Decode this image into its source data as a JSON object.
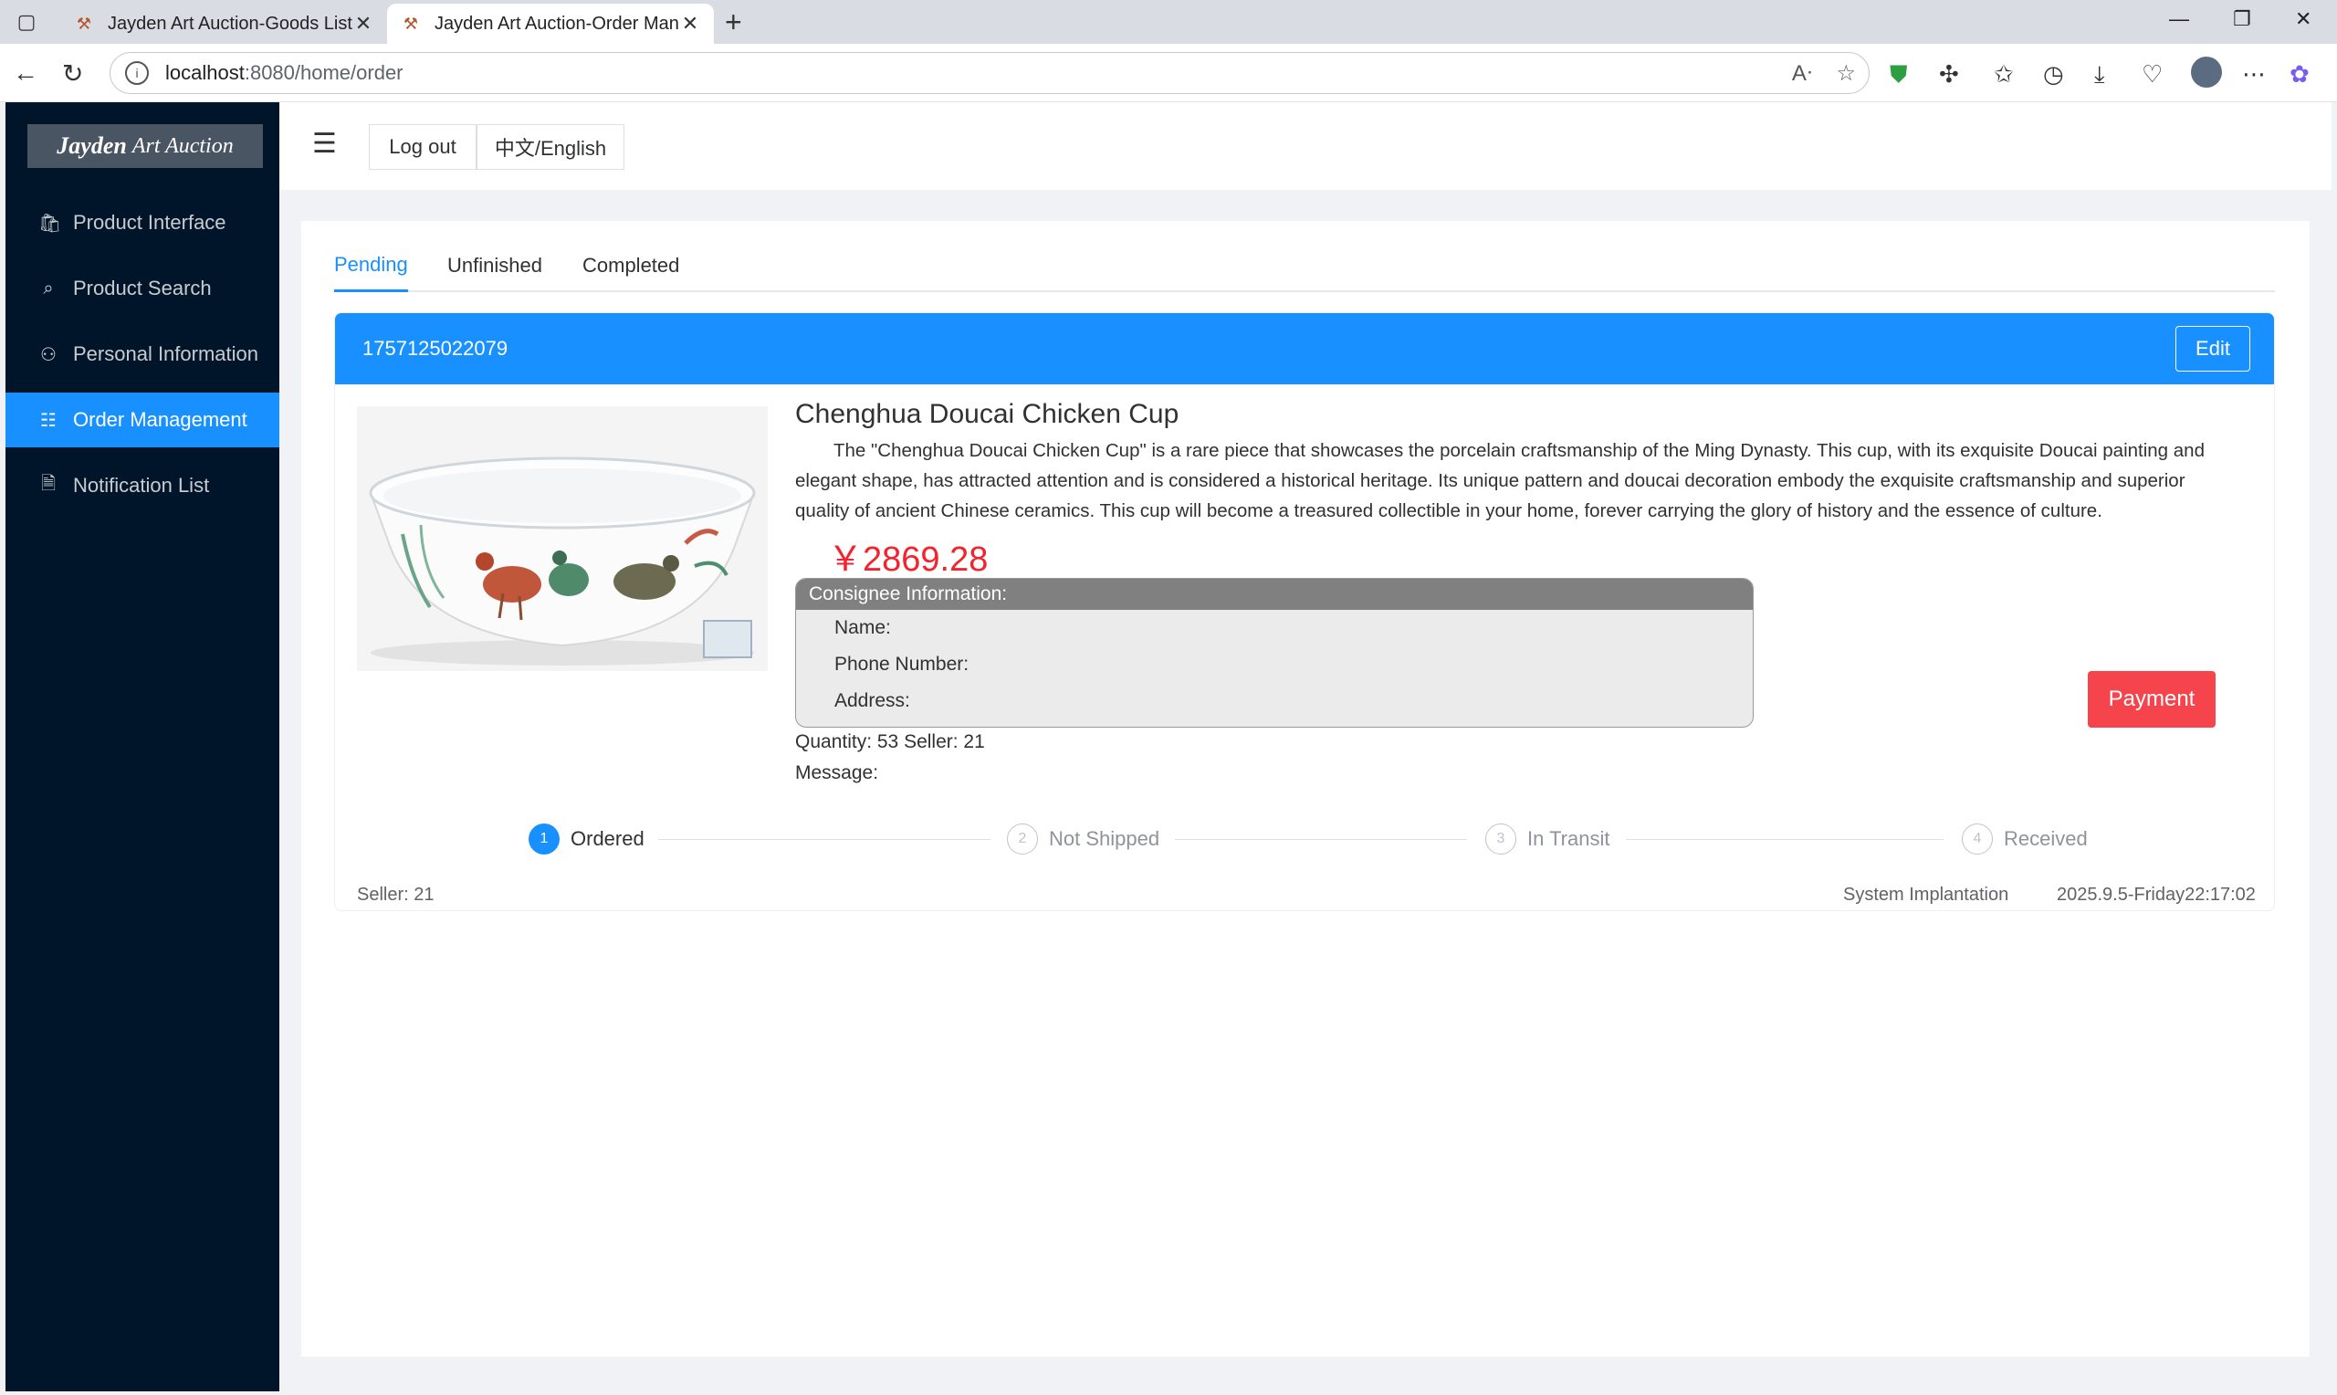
{
  "browser": {
    "tabs": [
      {
        "title": "Jayden Art Auction-Goods List"
      },
      {
        "title": "Jayden Art Auction-Order Manage"
      }
    ],
    "url_host": "localhost",
    "url_path": ":8080/home/order"
  },
  "app": {
    "logo_bold": "Jayden",
    "logo_rest": "Art Auction",
    "menu": [
      {
        "label": "Product Interface",
        "icon": "bag-icon"
      },
      {
        "label": "Product Search",
        "icon": "search-doc-icon"
      },
      {
        "label": "Personal Information",
        "icon": "user-icon"
      },
      {
        "label": "Order Management",
        "icon": "order-icon",
        "active": true
      },
      {
        "label": "Notification List",
        "icon": "document-icon"
      }
    ],
    "header": {
      "logout": "Log out",
      "language": "中文/English"
    }
  },
  "orders": {
    "tabs": [
      "Pending",
      "Unfinished",
      "Completed"
    ],
    "active_tab": "Pending",
    "order": {
      "id": "1757125022079",
      "edit_label": "Edit",
      "product_title": "Chenghua Doucai Chicken Cup",
      "description": "The \"Chenghua Doucai Chicken Cup\" is a rare piece that showcases the porcelain craftsmanship of the Ming Dynasty. This cup, with its exquisite Doucai painting and elegant shape, has attracted attention and is considered a historical heritage. Its unique pattern and doucai decoration embody the exquisite craftsmanship and superior quality of ancient Chinese ceramics. This cup will become a treasured collectible in your home, forever carrying the glory of history and the essence of culture.",
      "price": "￥2869.28",
      "consignee_header": "Consignee Information:",
      "name_label": "Name:",
      "phone_label": "Phone Number:",
      "address_label": "Address:",
      "pay_label": "Payment",
      "quantity_line": "Quantity: 53 Seller: 21",
      "message_label": "Message:",
      "steps": [
        {
          "num": "1",
          "label": "Ordered"
        },
        {
          "num": "2",
          "label": "Not Shipped"
        },
        {
          "num": "3",
          "label": "In Transit"
        },
        {
          "num": "4",
          "label": "Received"
        }
      ],
      "current_step": 1,
      "footer_seller": "Seller: 21",
      "footer_source": "System Implantation",
      "footer_time": "2025.9.5-Friday22:17:02"
    }
  },
  "colors": {
    "sidebar": "#001529",
    "accent": "#1890ff",
    "price": "#f5222d",
    "pay": "#f5444b"
  }
}
